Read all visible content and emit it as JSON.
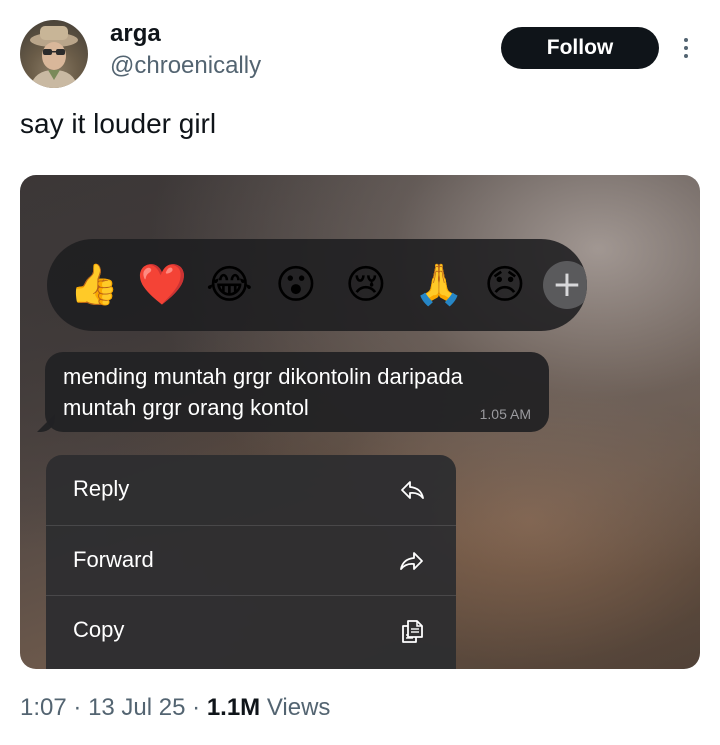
{
  "author": {
    "display_name": "arga",
    "handle": "@chroenically"
  },
  "follow_label": "Follow",
  "tweet": {
    "text": "say it louder girl"
  },
  "media": {
    "reactions": [
      "👍",
      "❤️",
      "😂",
      "😮",
      "😢",
      "🙏",
      "😞"
    ],
    "reaction_add": "+",
    "message": {
      "line1": "mending muntah grgr dikontolin daripada",
      "line2": "muntah grgr orang kontol",
      "time": "1.05 AM"
    },
    "menu": [
      {
        "label": "Reply",
        "icon": "reply-icon"
      },
      {
        "label": "Forward",
        "icon": "forward-icon"
      },
      {
        "label": "Copy",
        "icon": "copy-icon"
      }
    ]
  },
  "meta": {
    "time": "1:07",
    "date": "13 Jul 25",
    "sep": "·",
    "views_count": "1.1M",
    "views_label": "Views"
  },
  "colors": {
    "follow_bg": "#0f1419",
    "secondary_text": "#536471",
    "heart": "#e0245e"
  }
}
